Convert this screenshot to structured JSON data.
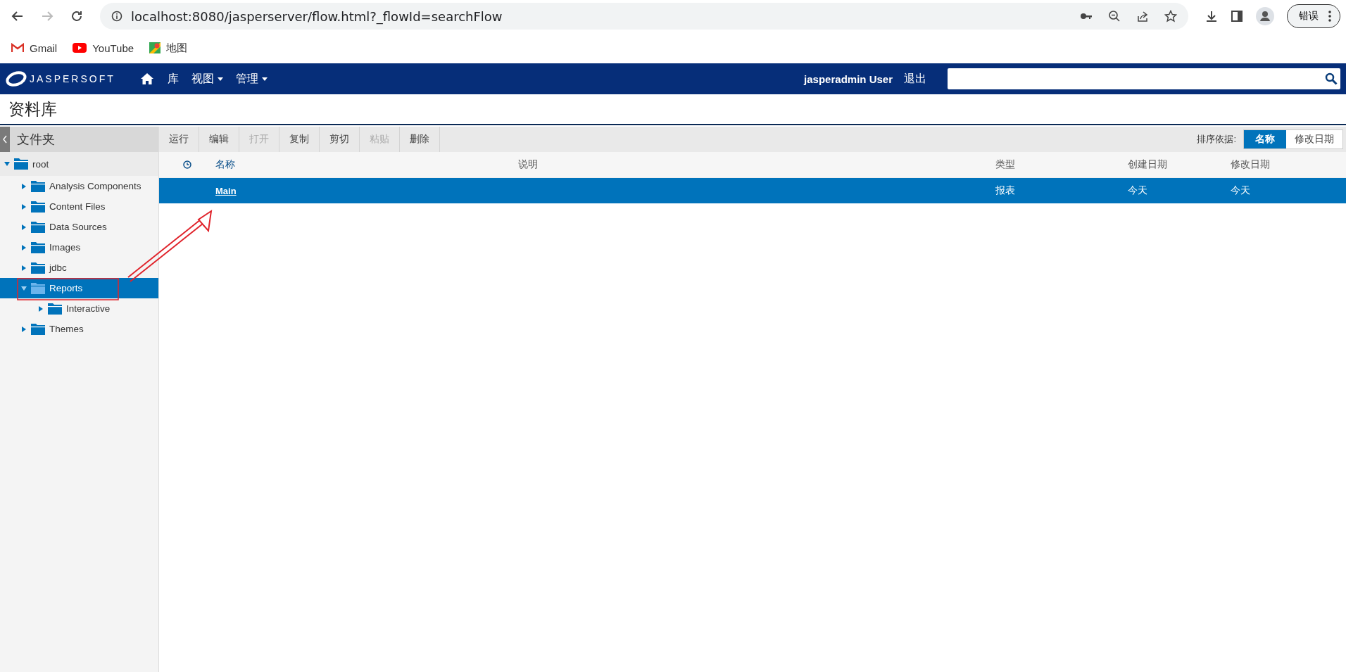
{
  "browser": {
    "url": "localhost:8080/jasperserver/flow.html?_flowId=searchFlow",
    "profile_button": "错误",
    "bookmarks": [
      "Gmail",
      "YouTube",
      "地图"
    ]
  },
  "header": {
    "logo": "JASPERSOFT",
    "nav": [
      {
        "label": "库",
        "dropdown": false
      },
      {
        "label": "视图",
        "dropdown": true
      },
      {
        "label": "管理",
        "dropdown": true
      }
    ],
    "user": "jasperadmin User",
    "logout": "退出"
  },
  "page_title": "资料库",
  "sidebar": {
    "title": "文件夹",
    "tree": [
      {
        "label": "root",
        "expanded": true,
        "selected": false,
        "children": [
          {
            "label": "Analysis Components",
            "expanded": false,
            "selected": false
          },
          {
            "label": "Content Files",
            "expanded": false,
            "selected": false
          },
          {
            "label": "Data Sources",
            "expanded": false,
            "selected": false
          },
          {
            "label": "Images",
            "expanded": false,
            "selected": false
          },
          {
            "label": "jdbc",
            "expanded": false,
            "selected": false
          },
          {
            "label": "Reports",
            "expanded": true,
            "selected": true,
            "children": [
              {
                "label": "Interactive",
                "expanded": false,
                "selected": false
              }
            ]
          },
          {
            "label": "Themes",
            "expanded": false,
            "selected": false
          }
        ]
      }
    ]
  },
  "toolbar": {
    "buttons": [
      {
        "label": "运行",
        "disabled": false
      },
      {
        "label": "编辑",
        "disabled": false
      },
      {
        "label": "打开",
        "disabled": true
      },
      {
        "label": "复制",
        "disabled": false
      },
      {
        "label": "剪切",
        "disabled": false
      },
      {
        "label": "粘贴",
        "disabled": true
      },
      {
        "label": "删除",
        "disabled": false
      }
    ],
    "sort_label": "排序依据:",
    "sort_options": [
      {
        "label": "名称",
        "selected": true
      },
      {
        "label": "修改日期",
        "selected": false
      }
    ]
  },
  "table": {
    "columns": [
      "名称",
      "说明",
      "类型",
      "创建日期",
      "修改日期"
    ],
    "rows": [
      {
        "cells": [
          "Main",
          "",
          "报表",
          "今天",
          "今天"
        ],
        "selected": true
      }
    ]
  }
}
